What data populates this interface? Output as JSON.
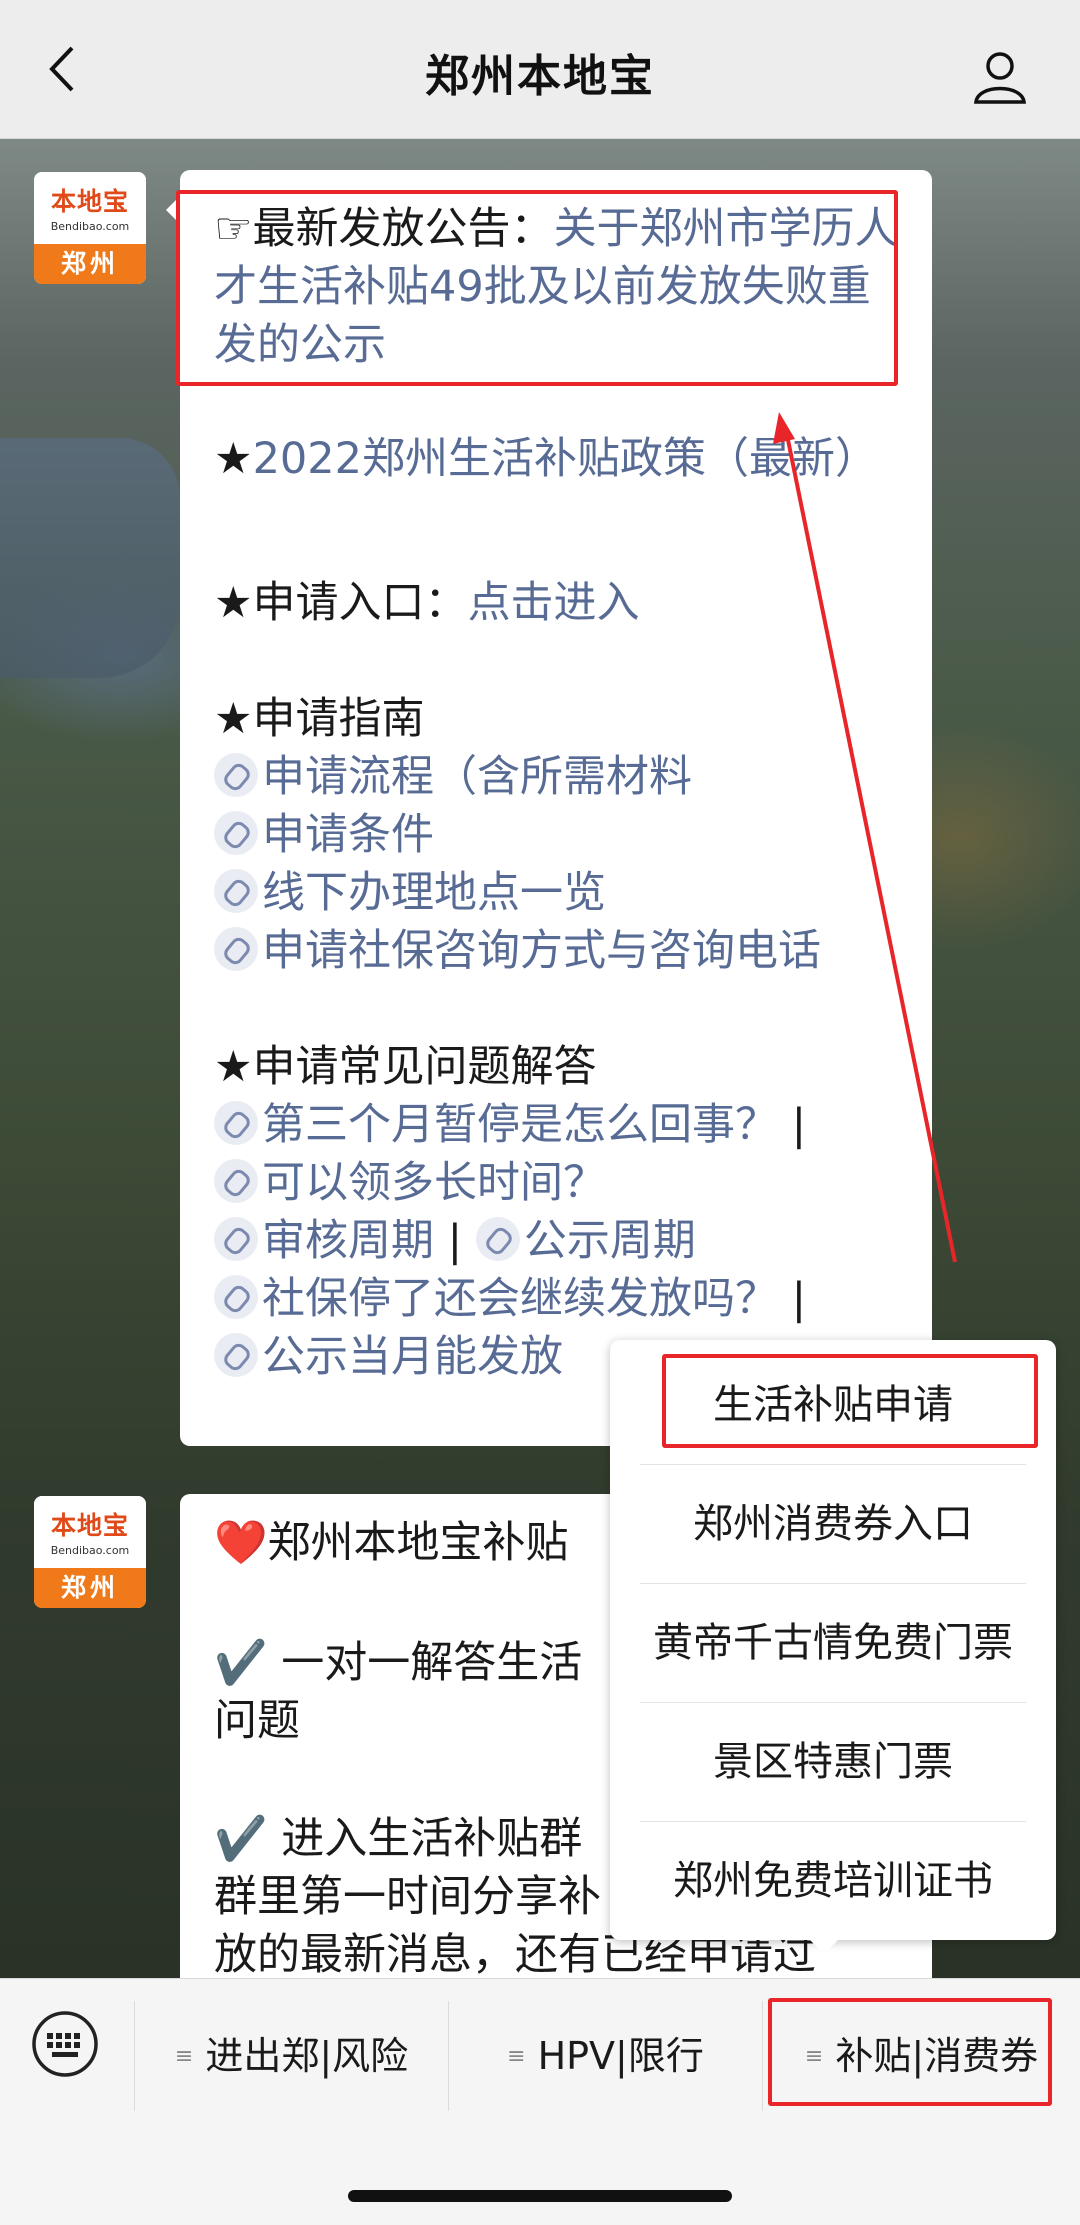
{
  "header": {
    "title": "郑州本地宝"
  },
  "avatar": {
    "logo": "本地宝",
    "site": "Bendibao.com",
    "city": "郑州"
  },
  "message1": {
    "announce_prefix": "☞最新发放公告：",
    "announce_link": "关于郑州市学历人才生活补贴49批及以前发放失败重发的公示",
    "policy_star": "★",
    "policy_link": "2022郑州生活补贴政策（最新）",
    "apply_label": "★申请入口：",
    "apply_link": "点击进入",
    "guide_title": "★申请指南",
    "guide_links": [
      "申请流程（含所需材料",
      "申请条件",
      "线下办理地点一览",
      "申请社保咨询方式与咨询电话"
    ],
    "faq_title": "★申请常见问题解答",
    "faq_links": [
      "第三个月暂停是怎么回事？",
      "可以领多长时间？",
      "审核周期",
      "公示周期",
      "社保停了还会继续发放吗？",
      "公示当月能发放"
    ],
    "faq_sep": "|"
  },
  "message2": {
    "line1": "❤️郑州本地宝补贴",
    "line2a": "✔️ 一对一解答生活",
    "line2b": "问题",
    "line3a": "✔️ 进入生活补贴群",
    "line3b": "群里第一时间分享补",
    "line3c": "放的最新消息，还有已经申请过"
  },
  "menu": {
    "items": [
      "生活补贴申请",
      "郑州消费券入口",
      "黄帝千古情免费门票",
      "景区特惠门票",
      "郑州免费培训证书"
    ]
  },
  "bottom_tabs": [
    "进出郑|风险",
    "HPV|限行",
    "补贴|消费券"
  ],
  "colors": {
    "link": "#576b95",
    "highlight": "#e8262a",
    "avatar_orange": "#f07a1a"
  }
}
